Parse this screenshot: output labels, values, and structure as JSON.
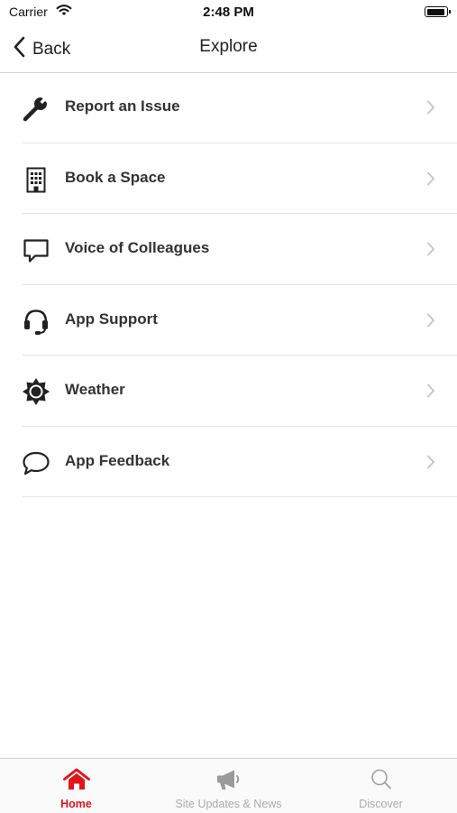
{
  "status_bar": {
    "carrier": "Carrier",
    "time": "2:48 PM"
  },
  "nav": {
    "back_label": "Back",
    "title": "Explore"
  },
  "menu": {
    "items": [
      {
        "label": "Report an Issue",
        "icon": "wrench-icon"
      },
      {
        "label": "Book a Space",
        "icon": "building-icon"
      },
      {
        "label": "Voice of Colleagues",
        "icon": "chat-bubble-icon"
      },
      {
        "label": "App Support",
        "icon": "headset-icon"
      },
      {
        "label": "Weather",
        "icon": "sun-icon"
      },
      {
        "label": "App Feedback",
        "icon": "speech-bubble-icon"
      }
    ]
  },
  "tabs": [
    {
      "label": "Home",
      "icon": "home-icon",
      "active": true
    },
    {
      "label": "Site Updates & News",
      "icon": "megaphone-icon",
      "active": false
    },
    {
      "label": "Discover",
      "icon": "search-icon",
      "active": false
    }
  ],
  "colors": {
    "accent": "#e1151b",
    "inactive": "#aaaaaa",
    "text": "#333333"
  }
}
